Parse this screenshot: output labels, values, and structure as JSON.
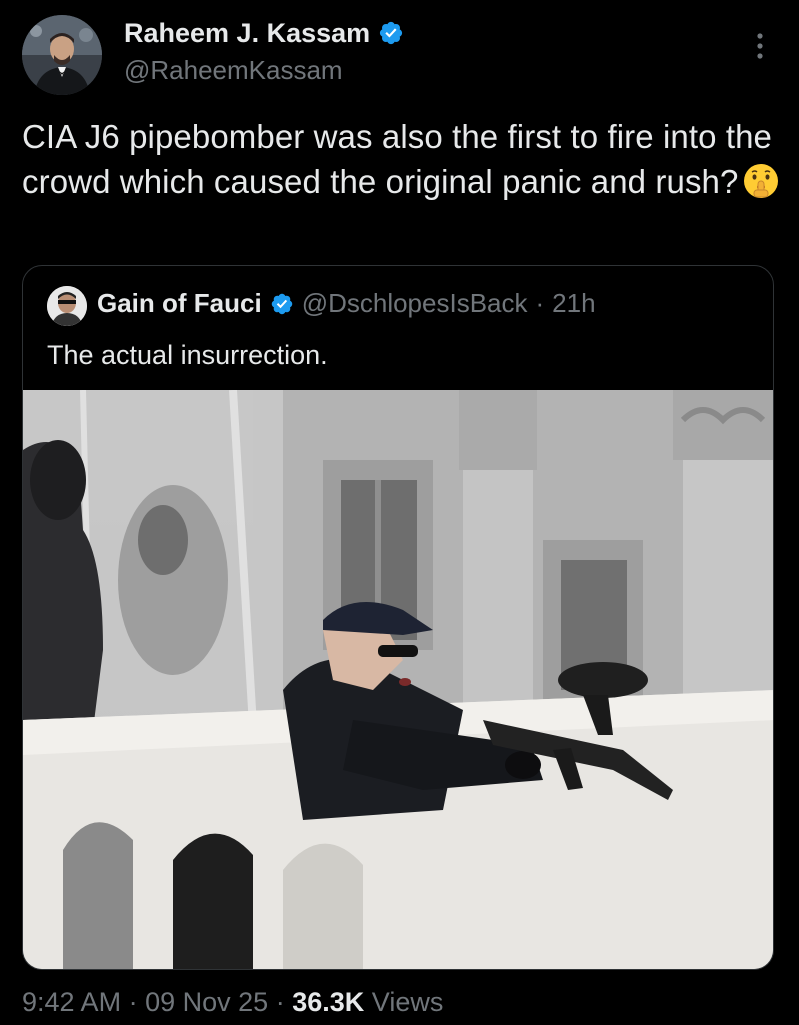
{
  "author": {
    "display_name": "Raheem J. Kassam",
    "handle": "@RaheemKassam",
    "verified_icon": "verified-badge-icon",
    "avatar": "profile-photo-avatar"
  },
  "tweet": {
    "text": "CIA J6 pipebomber was also the first to fire into the crowd which caused the original panic and rush?",
    "emoji": "shushing-face-emoji"
  },
  "quoted": {
    "display_name": "Gain of Fauci",
    "handle": "@DschlopesIsBack",
    "separator": "·",
    "time": "21h",
    "text": "The actual insurrection.",
    "media": "photo-officer-with-paintball-gun"
  },
  "footer": {
    "time": "9:42 AM",
    "sep1": "·",
    "date": "09 Nov 25",
    "sep2": "·",
    "views_count": "36.3K",
    "views_label": "Views"
  },
  "colors": {
    "background": "#000000",
    "text_primary": "#e7e9ea",
    "text_secondary": "#71767b",
    "border": "#2f3336",
    "verified_blue": "#1d9bf0"
  }
}
